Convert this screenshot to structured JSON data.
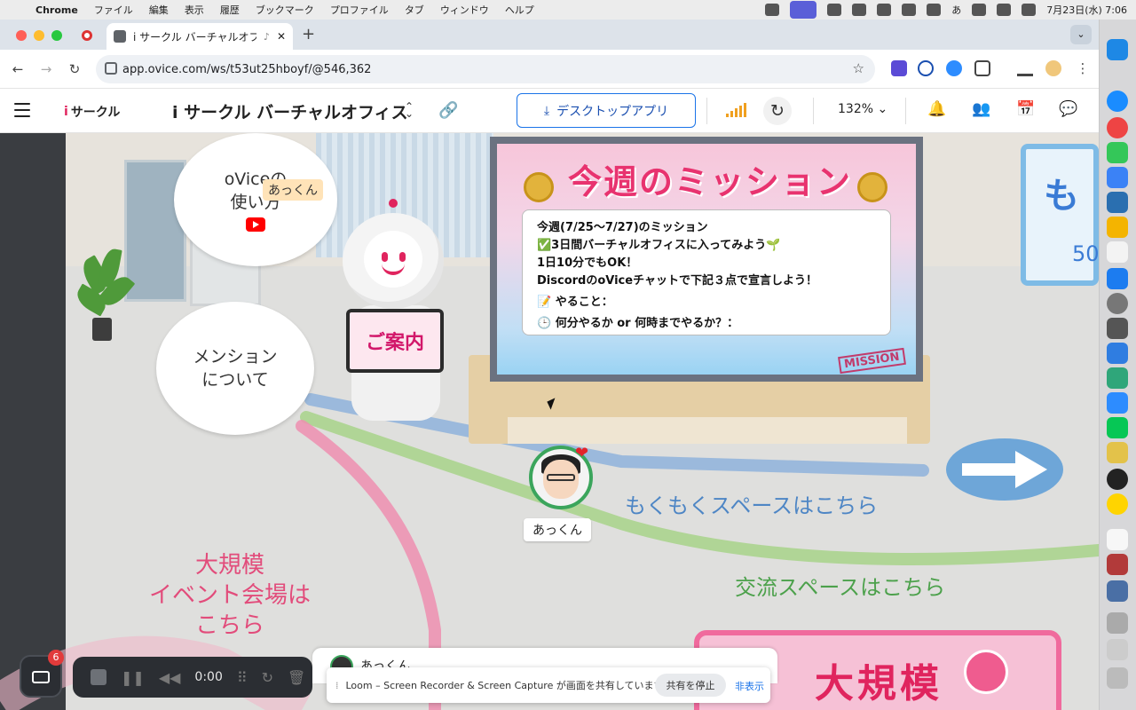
{
  "menubar": {
    "app": "Chrome",
    "items": [
      "ファイル",
      "編集",
      "表示",
      "履歴",
      "ブックマーク",
      "プロファイル",
      "タブ",
      "ウィンドウ",
      "ヘルプ"
    ],
    "clock": "7月23日(水) 7:06",
    "ime": "あ"
  },
  "browser": {
    "tab_title": "i サークル バーチャルオフィ",
    "url": "app.ovice.com/ws/t53ut25hboyf/@546,362",
    "new_tab": "+"
  },
  "header": {
    "logo": "サークル",
    "logo_i": "i",
    "space_name": "i サークル バーチャルオフィス",
    "desktop_app": "デスクトップアプリ",
    "zoom": "132%",
    "accent": "#1a73e8"
  },
  "map": {
    "bubble_ovice_line1": "oViceの",
    "bubble_ovice_line2": "使い方",
    "bubble_nametag": "あっくん",
    "bubble_mention_line1": "メンション",
    "bubble_mention_line2": "について",
    "robot_tablet": "ご案内",
    "mission_title": "今週のミッション",
    "mission_lines": [
      "今週(7/25〜7/27)のミッション",
      "✅3日間バーチャルオフィスに入ってみよう🌱",
      "1日10分でもOK！",
      "DiscordのoViceチャットで下記３点で宣言しよう！",
      "📝 やること：",
      "🕒 何分やるか or 何時までやるか？："
    ],
    "mission_stamp": "MISSION",
    "path_mokumoku": "もくもくスペースはこちら",
    "path_koryu": "交流スペースはこちら",
    "path_event_line1": "大規模",
    "path_event_line2": "イベント会場は",
    "path_event_line3": "こちら",
    "avatar_name": "あっくん",
    "right_room_text": "も",
    "right_room_num": "50",
    "event_room_text": "大規模"
  },
  "loom": {
    "badge": "6",
    "time": "0:00"
  },
  "ovice_toolbar": {
    "me_name": "あっくん"
  },
  "share_banner": {
    "message": "Loom – Screen Recorder & Screen Capture が画面を共有しています。",
    "stop": "共有を停止",
    "hide": "非表示"
  }
}
